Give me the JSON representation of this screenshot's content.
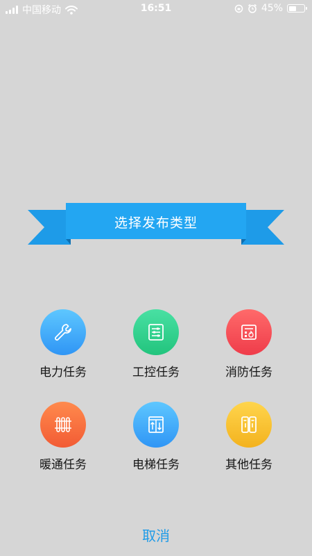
{
  "status_bar": {
    "carrier": "中国移动",
    "time": "16:51",
    "battery_percent": "45%",
    "battery_level": 0.45
  },
  "dialog": {
    "title": "选择发布类型",
    "ribbon_color": "#1e9be8",
    "cancel_label": "取消"
  },
  "tasks": [
    {
      "label": "电力任务",
      "icon": "wrench-icon",
      "color_top": "#5ec7ff",
      "color_bottom": "#2f95f5"
    },
    {
      "label": "工控任务",
      "icon": "control-panel-icon",
      "color_top": "#49e0a3",
      "color_bottom": "#22c47d"
    },
    {
      "label": "消防任务",
      "icon": "fire-panel-icon",
      "color_top": "#ff6a6a",
      "color_bottom": "#ef3c4a"
    },
    {
      "label": "暖通任务",
      "icon": "radiator-icon",
      "color_top": "#ff8a4d",
      "color_bottom": "#f25b34"
    },
    {
      "label": "电梯任务",
      "icon": "elevator-icon",
      "color_top": "#5ec7ff",
      "color_bottom": "#2f95f5"
    },
    {
      "label": "其他任务",
      "icon": "fridge-icon",
      "color_top": "#ffd54d",
      "color_bottom": "#f3b21e"
    }
  ]
}
